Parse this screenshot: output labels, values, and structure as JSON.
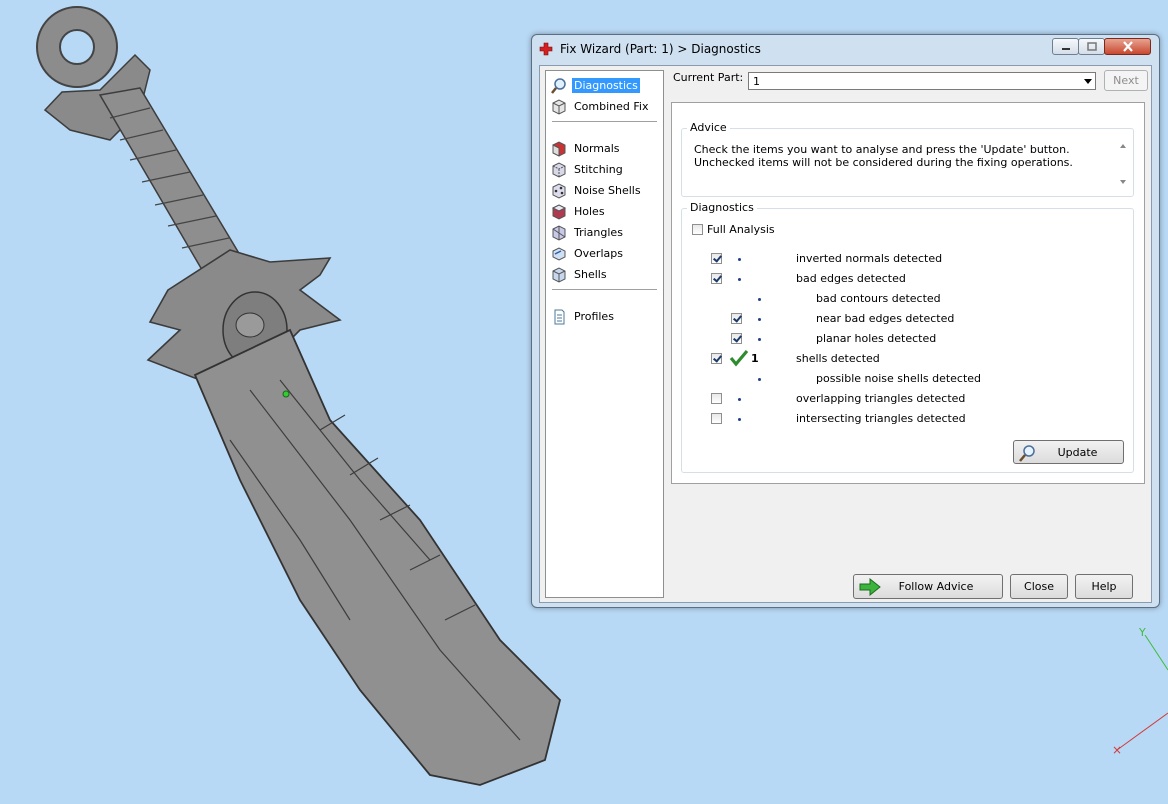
{
  "window": {
    "title": "Fix Wizard (Part: 1) > Diagnostics",
    "controls": [
      "minimize",
      "maximize",
      "close"
    ]
  },
  "nav": {
    "items": [
      {
        "label": "Diagnostics",
        "icon": "magnifier-icon",
        "selected": true
      },
      {
        "label": "Combined Fix",
        "icon": "cube-icon"
      },
      {
        "label": "Normals",
        "icon": "normals-cube-icon"
      },
      {
        "label": "Stitching",
        "icon": "stitching-cube-icon"
      },
      {
        "label": "Noise Shells",
        "icon": "noise-shells-icon"
      },
      {
        "label": "Holes",
        "icon": "holes-cube-icon"
      },
      {
        "label": "Triangles",
        "icon": "triangles-cube-icon"
      },
      {
        "label": "Overlaps",
        "icon": "overlaps-icon"
      },
      {
        "label": "Shells",
        "icon": "shells-cube-icon"
      },
      {
        "label": "Profiles",
        "icon": "document-icon"
      }
    ]
  },
  "current_part": {
    "label": "Current Part:",
    "value": "1",
    "next_label": "Next"
  },
  "advice": {
    "title": "Advice",
    "text": "Check the items you want to analyse and press the 'Update' button. Unchecked items will not be considered during the fixing operations."
  },
  "diagnostics": {
    "title": "Diagnostics",
    "full_analysis_label": "Full Analysis",
    "full_analysis_checked": false,
    "rows": [
      {
        "label": "inverted normals detected",
        "checked": true,
        "indent": 0,
        "status": "dot"
      },
      {
        "label": "bad edges detected",
        "checked": true,
        "indent": 0,
        "status": "dot"
      },
      {
        "label": "bad contours detected",
        "checked": null,
        "indent": 1,
        "status": "dot"
      },
      {
        "label": "near bad edges detected",
        "checked": true,
        "indent": 1,
        "status": "dot"
      },
      {
        "label": "planar holes detected",
        "checked": true,
        "indent": 1,
        "status": "dot"
      },
      {
        "label": "shells detected",
        "checked": true,
        "indent": 0,
        "status": "ok",
        "count": "1"
      },
      {
        "label": "possible noise shells detected",
        "checked": null,
        "indent": 1,
        "status": "dot"
      },
      {
        "label": "overlapping triangles detected",
        "checked": false,
        "indent": 0,
        "status": "dot"
      },
      {
        "label": "intersecting triangles detected",
        "checked": false,
        "indent": 0,
        "status": "dot"
      }
    ],
    "update_label": "Update"
  },
  "footer": {
    "follow_advice_label": "Follow Advice",
    "close_label": "Close",
    "help_label": "Help"
  },
  "viewport": {
    "axis_y_label": "Y",
    "axis_x_marker": "×",
    "colors": {
      "background": "#b8d9f5",
      "model": "#8f8f8f",
      "axis_y": "#3dbb3d",
      "axis_x": "#d23a3a"
    }
  }
}
